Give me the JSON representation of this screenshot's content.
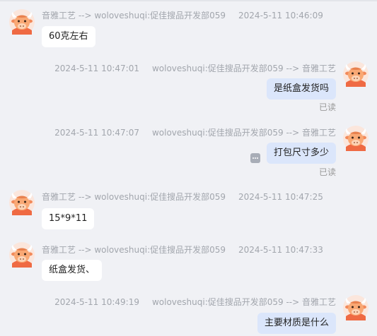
{
  "messages": [
    {
      "direction": "in",
      "from": "音雅工艺 --> woloveshuqi:促佳搜品开发部059",
      "time": "2024-5-11 10:46:09",
      "text": "60克左右"
    },
    {
      "direction": "out",
      "from": "woloveshuqi:促佳搜品开发部059 --> 音雅工艺",
      "time": "2024-5-11 10:47:01",
      "text": "是纸盒发货吗",
      "status": "已读"
    },
    {
      "direction": "out",
      "from": "woloveshuqi:促佳搜品开发部059 --> 音雅工艺",
      "time": "2024-5-11 10:47:07",
      "text": "打包尺寸多少",
      "status": "已读"
    },
    {
      "direction": "in",
      "from": "音雅工艺 --> woloveshuqi:促佳搜品开发部059",
      "time": "2024-5-11 10:47:25",
      "text": "15*9*11"
    },
    {
      "direction": "in",
      "from": "音雅工艺 --> woloveshuqi:促佳搜品开发部059",
      "time": "2024-5-11 10:47:33",
      "text": "纸盒发货、"
    },
    {
      "direction": "out",
      "from": "woloveshuqi:促佳搜品开发部059 --> 音雅工艺",
      "time": "2024-5-11 10:49:19",
      "text": "主要材质是什么"
    }
  ],
  "colors": {
    "background": "#f0f1f5",
    "incoming_bubble": "#ffffff",
    "outgoing_bubble": "#dbe6fb",
    "meta_text": "#a2a6ad"
  },
  "icons": {
    "avatar": "cartoon-bull-avatar-icon",
    "more": "more-options-icon"
  }
}
